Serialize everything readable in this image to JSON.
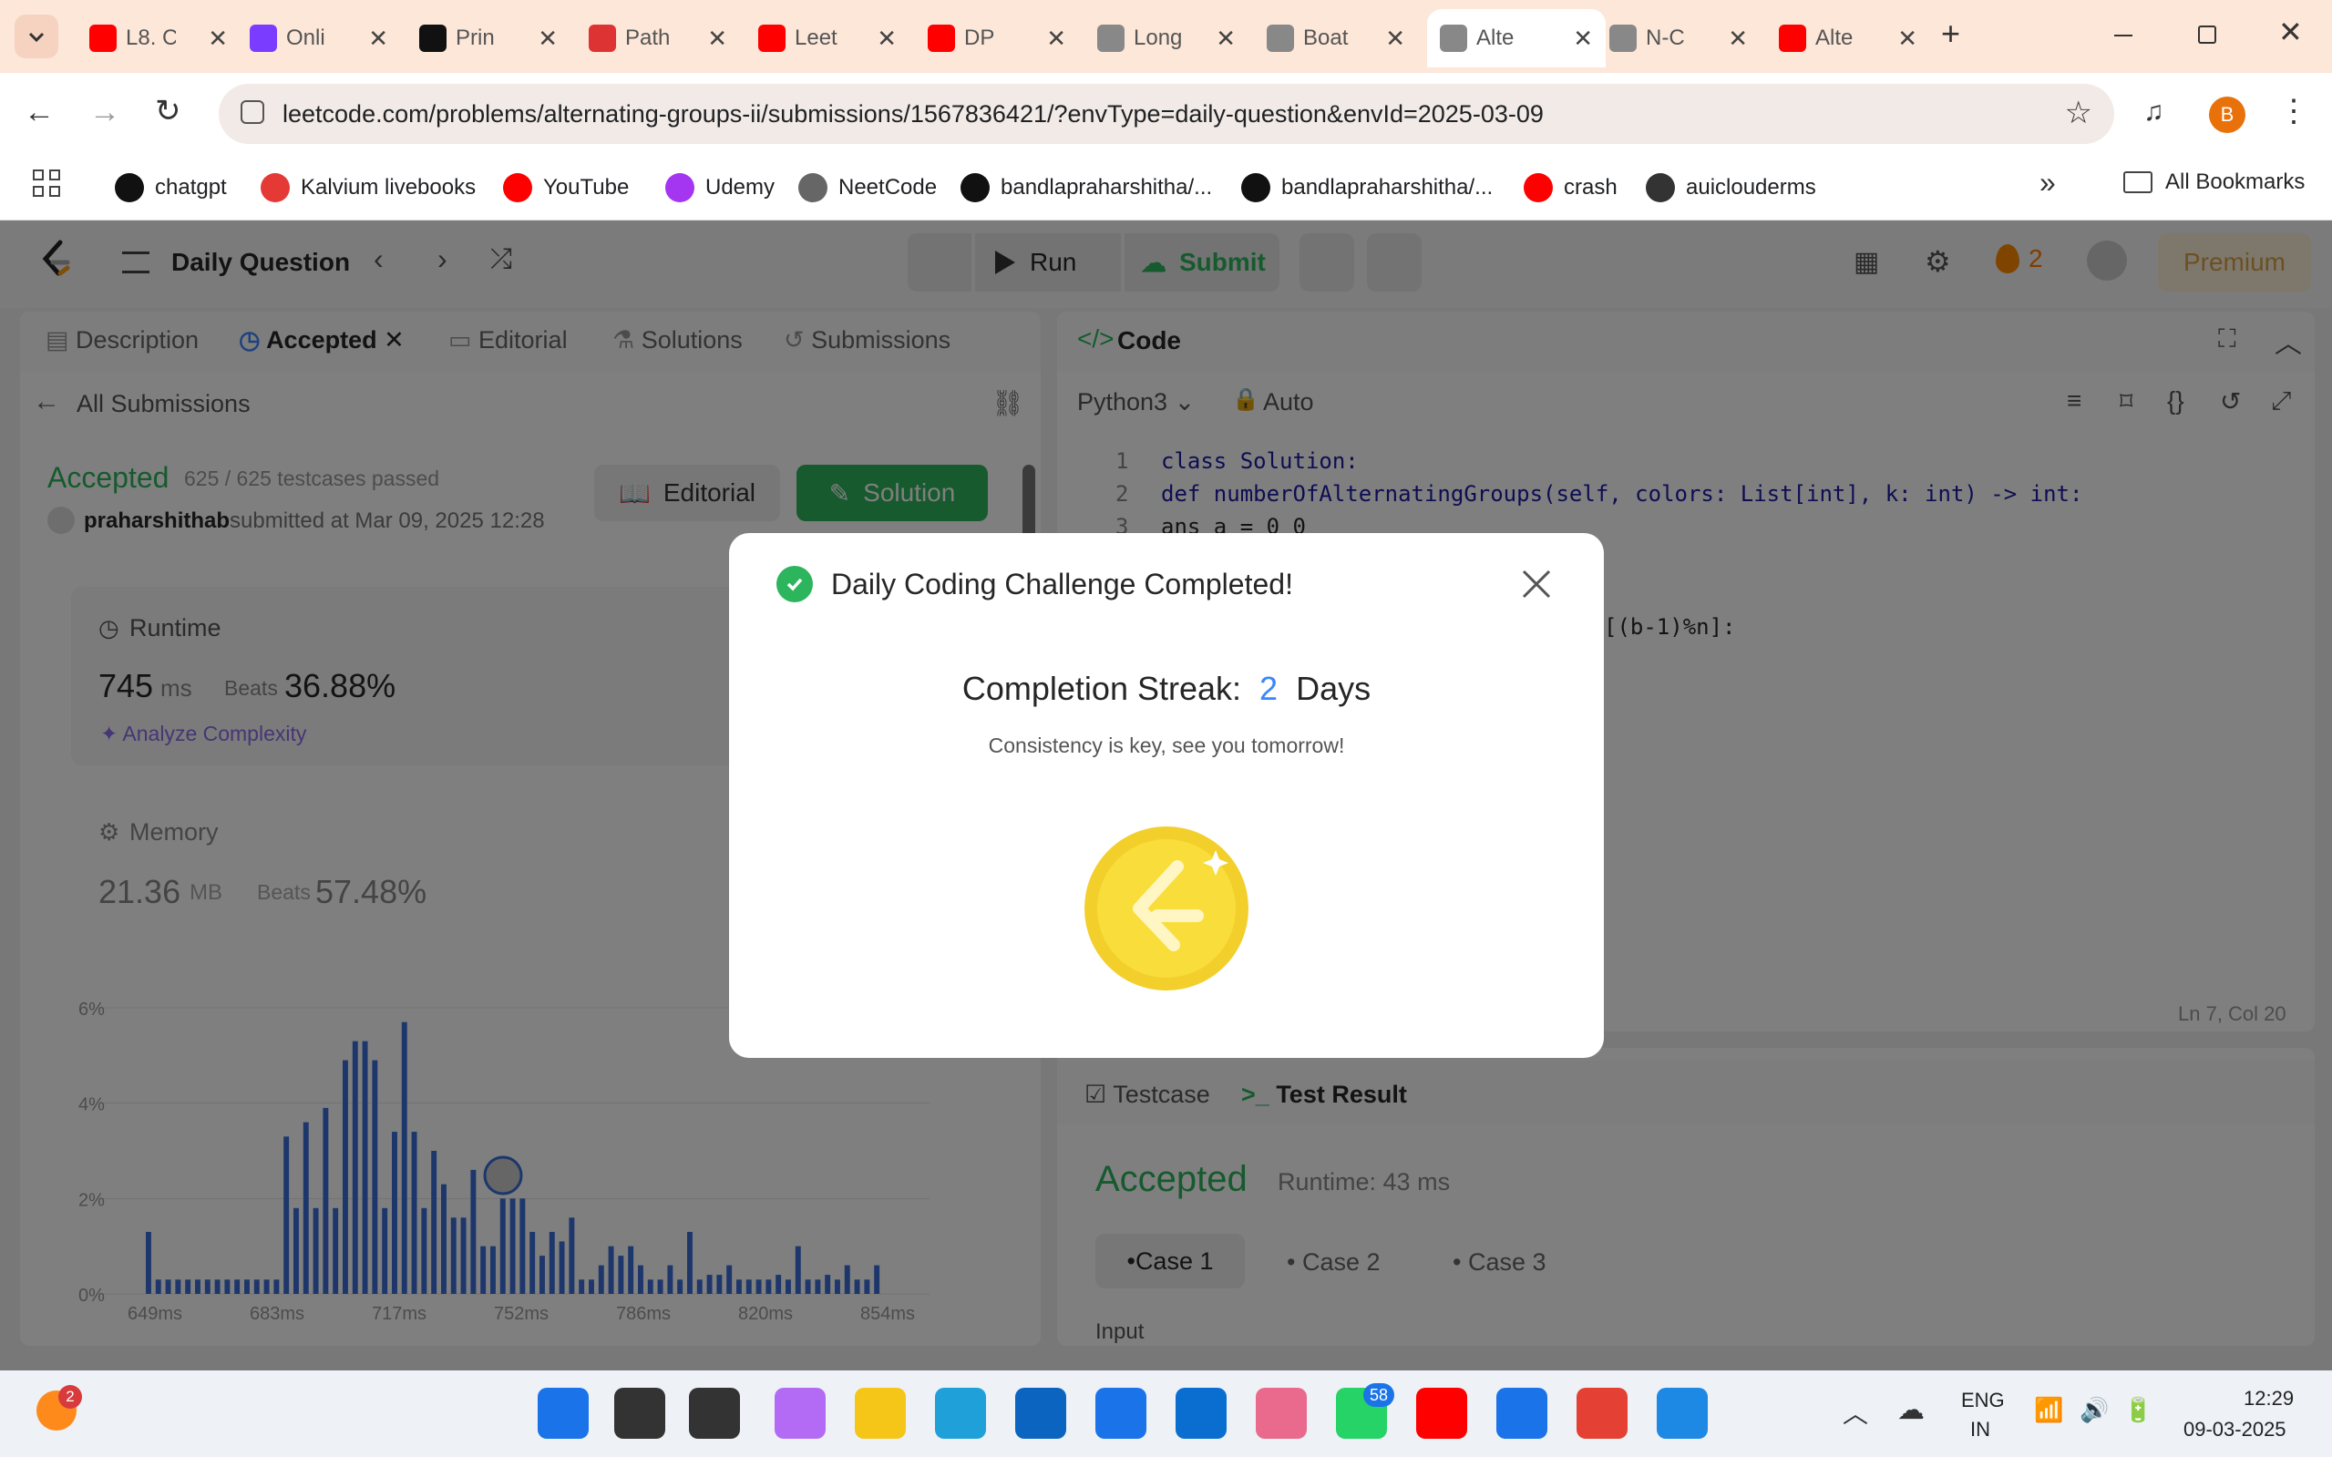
{
  "tabs": [
    {
      "title": "L8. C",
      "color": "#ff0000"
    },
    {
      "title": "Onli",
      "color": "#7a3cff"
    },
    {
      "title": "Prin",
      "color": "#111111"
    },
    {
      "title": "Path",
      "color": "#d33"
    },
    {
      "title": "Leet",
      "color": "#ff0000"
    },
    {
      "title": "DP",
      "color": "#ff0000"
    },
    {
      "title": "Long",
      "color": "#888"
    },
    {
      "title": "Boat",
      "color": "#888"
    },
    {
      "title": "Alte",
      "color": "#888"
    },
    {
      "title": "N-C",
      "color": "#888"
    },
    {
      "title": "Alte",
      "color": "#ff0000"
    }
  ],
  "browser": {
    "url": "leetcode.com/problems/alternating-groups-ii/submissions/1567836421/?envType=daily-question&envId=2025-03-09",
    "profile_initial": "B"
  },
  "bookmarks": [
    "chatgpt",
    "Kalvium livebooks",
    "YouTube",
    "Udemy",
    "NeetCode",
    "bandlapraharshitha/...",
    "bandlapraharshitha/...",
    "crash",
    "auiclouderms"
  ],
  "all_bookmarks": "All Bookmarks",
  "lc": {
    "daily_question": "Daily Question",
    "run": "Run",
    "submit": "Submit",
    "streak_count": "2",
    "premium": "Premium",
    "left_tabs": [
      "Description",
      "Accepted",
      "Editorial",
      "Solutions",
      "Submissions"
    ],
    "all_submissions": "All Submissions",
    "status": "Accepted",
    "testcases": "625 / 625 testcases passed",
    "user": "praharshithab",
    "submitted_at": "submitted at Mar 09, 2025 12:28",
    "editorial_btn": "Editorial",
    "solution_btn": "Solution",
    "runtime_label": "Runtime",
    "runtime_value": "745",
    "runtime_unit": "ms",
    "beats_label": "Beats",
    "runtime_beats": "36.88%",
    "analyze": "Analyze Complexity",
    "memory_label": "Memory",
    "memory_value": "21.36",
    "memory_unit": "MB",
    "memory_beats": "57.48%",
    "code_title": "Code",
    "language": "Python3",
    "auto": "Auto",
    "code_lines": [
      "class Solution:",
      "    def numberOfAlternatingGroups(self, colors: List[int], k: int) -> int:",
      "        ans a = 0 0"
    ],
    "line_numbers": [
      "1",
      "2",
      "3"
    ],
    "code_fragment": "[(b-1)%n]:",
    "cursor_pos": "Ln 7, Col 20",
    "testcase_tab": "Testcase",
    "result_tab": "Test Result",
    "result_status": "Accepted",
    "result_runtime": "Runtime: 43 ms",
    "cases": [
      "Case 1",
      "Case 2",
      "Case 3"
    ],
    "input_label": "Input"
  },
  "chart_data": {
    "type": "bar",
    "ylabel_ticks": [
      "6%",
      "4%",
      "2%",
      "0%"
    ],
    "x_ticks": [
      "649ms",
      "683ms",
      "717ms",
      "752ms",
      "786ms",
      "820ms",
      "854ms"
    ],
    "ylim": [
      0,
      6
    ],
    "values": [
      1.3,
      0.3,
      0.3,
      0.3,
      0.3,
      0.3,
      0.3,
      0.3,
      0.3,
      0.3,
      0.3,
      0.3,
      0.3,
      0.3,
      3.3,
      1.8,
      3.6,
      1.8,
      3.9,
      1.8,
      4.9,
      5.3,
      5.3,
      4.9,
      1.8,
      3.4,
      5.7,
      3.4,
      1.8,
      3.0,
      2.3,
      1.6,
      1.6,
      2.6,
      1.0,
      1.0,
      2.0,
      2.0,
      2.0,
      1.3,
      0.8,
      1.3,
      1.1,
      1.6,
      0.3,
      0.3,
      0.6,
      1.0,
      0.8,
      1.0,
      0.6,
      0.3,
      0.3,
      0.6,
      0.3,
      1.3,
      0.3,
      0.4,
      0.4,
      0.6,
      0.3,
      0.3,
      0.3,
      0.3,
      0.4,
      0.3,
      1.0,
      0.3,
      0.3,
      0.4,
      0.3,
      0.6,
      0.3,
      0.3,
      0.6
    ]
  },
  "modal": {
    "title": "Daily Coding Challenge Completed!",
    "streak_label": "Completion Streak:",
    "streak_days": "2",
    "days_word": "Days",
    "subtitle": "Consistency is key, see you tomorrow!"
  },
  "taskbar": {
    "notif_count": "2",
    "whatsapp_badge": "58",
    "lang_line1": "ENG",
    "lang_line2": "IN",
    "time": "12:29",
    "date": "09-03-2025"
  }
}
